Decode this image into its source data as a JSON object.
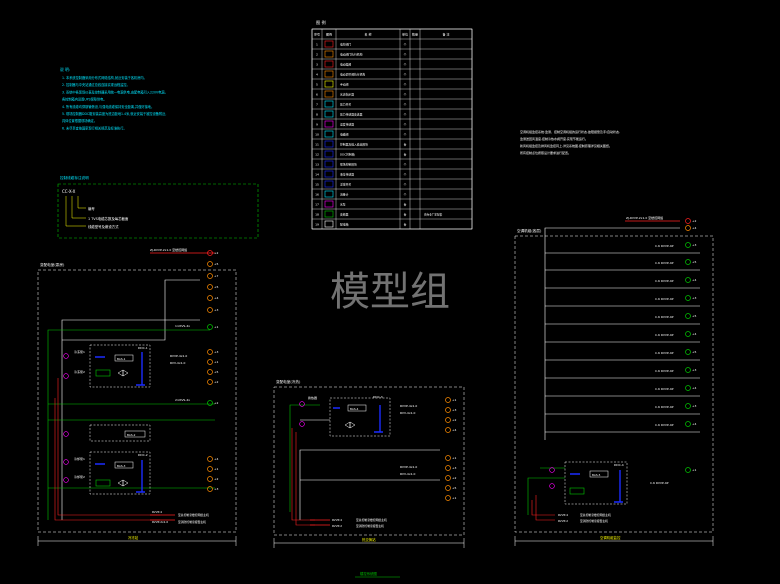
{
  "watermark": "模型组",
  "legend": {
    "title": "图 例",
    "headers": [
      "序号",
      "图例",
      "名 称",
      "单位",
      "数量",
      "备 注"
    ],
    "rows": [
      {
        "no": "1",
        "name": "电控阀门",
        "unit": "个",
        "qty": "",
        "note": ""
      },
      {
        "no": "2",
        "name": "电动阀门执行机构",
        "unit": "个",
        "qty": "",
        "note": ""
      },
      {
        "no": "3",
        "name": "电动蝶阀",
        "unit": "个",
        "qty": "",
        "note": ""
      },
      {
        "no": "4",
        "name": "电动调节阀执行机构",
        "unit": "个",
        "qty": "",
        "note": ""
      },
      {
        "no": "5",
        "name": "手动阀",
        "unit": "个",
        "qty": "",
        "note": ""
      },
      {
        "no": "6",
        "name": "水流指示器",
        "unit": "个",
        "qty": "",
        "note": ""
      },
      {
        "no": "7",
        "name": "压力开关",
        "unit": "个",
        "qty": "",
        "note": ""
      },
      {
        "no": "8",
        "name": "压力传感器变送器",
        "unit": "个",
        "qty": "",
        "note": ""
      },
      {
        "no": "9",
        "name": "温度传感器",
        "unit": "个",
        "qty": "",
        "note": ""
      },
      {
        "no": "10",
        "name": "电磁阀",
        "unit": "个",
        "qty": "",
        "note": ""
      },
      {
        "no": "11",
        "name": "控制器及输入输出模块",
        "unit": "台",
        "qty": "",
        "note": ""
      },
      {
        "no": "12",
        "name": "DDC控制箱",
        "unit": "台",
        "qty": "",
        "note": ""
      },
      {
        "no": "13",
        "name": "现场控制模块",
        "unit": "个",
        "qty": "",
        "note": ""
      },
      {
        "no": "14",
        "name": "液位传感器",
        "unit": "个",
        "qty": "",
        "note": ""
      },
      {
        "no": "15",
        "name": "浮球开关",
        "unit": "个",
        "qty": "",
        "note": ""
      },
      {
        "no": "16",
        "name": "流量计",
        "unit": "个",
        "qty": "",
        "note": ""
      },
      {
        "no": "17",
        "name": "水泵",
        "unit": "台",
        "qty": "",
        "note": ""
      },
      {
        "no": "18",
        "name": "变频器",
        "unit": "台",
        "qty": "",
        "note": "由专业厂家配套"
      },
      {
        "no": "19",
        "name": "配电箱",
        "unit": "台",
        "qty": "",
        "note": ""
      }
    ]
  },
  "notes_left": {
    "title": "说 明:",
    "lines": [
      "1. 本系统控制器采用分布式网络结构,就近安装于各机房内。",
      "2. 控制器与中央站通过总线连接实现远程监控。",
      "3. 系统中各现场仪表及控制器采用统一电源供电,由配电箱引入220V电源。",
      "   各控制箱内设置UPS保障供电。",
      "4. 所有线缆均穿钢管敷设,与强电线缆保持安全距离,并做好接地。",
      "5. 现场控制器DDC箱安装高度为底边距地1.4米,就近安装于被控设备附近,",
      "   具体位置根据现场确定。",
      "6. 未尽事宜按国家现行相关规范及标准执行。"
    ]
  },
  "label_explain": {
    "title": "控制线缆标注说明",
    "sample": "CC-X-X",
    "items": [
      "编号",
      "1 TVS电缆芯数及每芯截面",
      "线缆型号及敷设方式"
    ]
  },
  "notes_right": {
    "lines": [
      "空调机组监控系统:监测、控制空调机组的运行状态,故障报警及手/自动状态,",
      "  监测送回风温度,控制冷热水阀开度,实现节能运行。",
      "  新风机组监控及排风机监控同上,详见系统图,控制原理详见相关图纸。",
      "  所有控制点位按照设计要求进行配置。"
    ]
  },
  "panels": [
    {
      "id": "left",
      "title": "变配电室(泵房)",
      "footer": "冷冻站"
    },
    {
      "id": "mid",
      "title": "变配电室(冷热)",
      "footer": "热交换站"
    },
    {
      "id": "right",
      "title": "空调机组(各层)",
      "footer": "空调机组监控"
    }
  ],
  "left_panel": {
    "bus_label": "ZJ-RVVP-2x1.0 至楼控网络",
    "cable_a": "RVVP-4x1.0",
    "cable_b": "RVV-4x1.0",
    "feed_top": "1×RVS-4x",
    "feed_mid": "2×RVS-4x",
    "pump_a": "冷冻泵1",
    "pump_b": "冷冻泵2",
    "pump_c": "冷却泵1",
    "pump_d": "冷却泵2",
    "ddc_a": "DDC-1",
    "ddc_b": "DDC-2",
    "box_a": "BAS-1",
    "box_b": "BAS-2",
    "box_c": "BAS-3",
    "out_red": "RVVP-4",
    "out_red_desc": "至总控制室楼控网络主机",
    "out_red2": "RVVP-2x1.0",
    "out_red2_desc": "至消防控制室报警主机",
    "pts": [
      "+2",
      "+5",
      "+7",
      "+5",
      "+4",
      "+3",
      "+1",
      "+2",
      "+3",
      "+1",
      "+5",
      "+2",
      "+4",
      "+1",
      "+2",
      "+3",
      "+1",
      "+5",
      "+2",
      "+4",
      "+1",
      "+2",
      "+3",
      "+4",
      "+1",
      "+2"
    ]
  },
  "mid_panel": {
    "ddc": "DDC-3",
    "box": "BAS-4",
    "pump": "换热器",
    "cable_a": "RVVP-4x1.0",
    "cable_b": "RVV-4x1.0",
    "out_red": "RVVP-4",
    "out_red_desc": "至总控制室楼控网络主机",
    "out_red2": "RVVP-2",
    "out_red2_desc": "至消防控制室报警主机",
    "pts": [
      "+1",
      "+3",
      "+2",
      "+4",
      "+1",
      "+3",
      "+2",
      "+5",
      "+1",
      "+4"
    ]
  },
  "right_panel": {
    "bus_label": "ZJ-RVVP-2x1.0 至楼控网络",
    "ddc": "DDC-4",
    "box": "BAS-5",
    "cable": "C.6 RVVP-4P",
    "out_red": "RVVP-4",
    "out_red_desc": "至总控制室楼控网络主机",
    "out_red2": "RVVP-2",
    "out_red2_desc": "至消防控制室报警主机",
    "pts": [
      "+2",
      "+4",
      "+3",
      "+5",
      "+4",
      "+3",
      "+5",
      "+4",
      "+5",
      "+3",
      "+4",
      "+3",
      "+4",
      "+1"
    ]
  },
  "bottom_caption": "楼控系统图",
  "colors": {
    "bg": "#000000",
    "line": "#ffffff",
    "green": "#00c800",
    "blue": "#1a2cff",
    "red": "#ff2020",
    "magenta": "#ff00ff",
    "yellow": "#ffff00",
    "orange": "#ff8c00",
    "cyan": "#00e5ff",
    "grey": "#9a9a9a"
  }
}
